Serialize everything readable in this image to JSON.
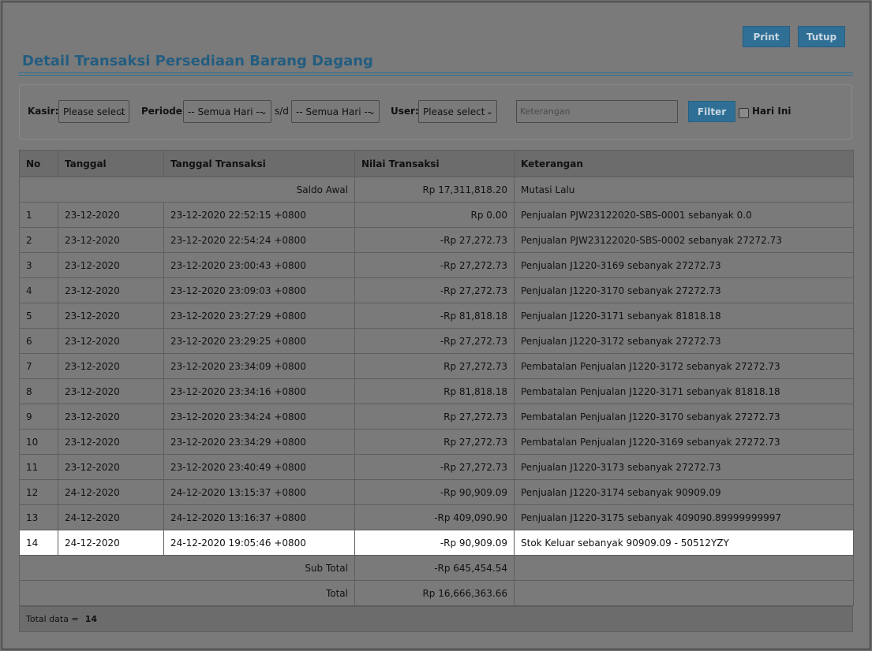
{
  "toolbar": {
    "print_label": "Print",
    "close_label": "Tutup"
  },
  "page_title": "Detail Transaksi Persediaan Barang Dagang",
  "filter": {
    "kasir_label": "Kasir:",
    "kasir_value": "Please select",
    "periode_label": "Periode:",
    "periode_from": "-- Semua Hari --",
    "sd_label": "s/d",
    "periode_to": "-- Semua Hari --",
    "user_label": "User:",
    "user_value": "Please select",
    "keterangan_placeholder": "Keterangan",
    "filter_label": "Filter",
    "hari_ini_label": "Hari Ini"
  },
  "table": {
    "headers": [
      "No",
      "Tanggal",
      "Tanggal Transaksi",
      "Nilai Transaksi",
      "Keterangan"
    ],
    "saldo_awal": {
      "label": "Saldo Awal",
      "value": "Rp 17,311,818.20",
      "keterangan": "Mutasi Lalu"
    },
    "rows": [
      [
        "1",
        "23-12-2020",
        "23-12-2020 22:52:15 +0800",
        "Rp 0.00",
        "Penjualan PJW23122020-SBS-0001 sebanyak 0.0"
      ],
      [
        "2",
        "23-12-2020",
        "23-12-2020 22:54:24 +0800",
        "-Rp 27,272.73",
        "Penjualan PJW23122020-SBS-0002 sebanyak 27272.73"
      ],
      [
        "3",
        "23-12-2020",
        "23-12-2020 23:00:43 +0800",
        "-Rp 27,272.73",
        "Penjualan J1220-3169 sebanyak 27272.73"
      ],
      [
        "4",
        "23-12-2020",
        "23-12-2020 23:09:03 +0800",
        "-Rp 27,272.73",
        "Penjualan J1220-3170 sebanyak 27272.73"
      ],
      [
        "5",
        "23-12-2020",
        "23-12-2020 23:27:29 +0800",
        "-Rp 81,818.18",
        "Penjualan J1220-3171 sebanyak 81818.18"
      ],
      [
        "6",
        "23-12-2020",
        "23-12-2020 23:29:25 +0800",
        "-Rp 27,272.73",
        "Penjualan J1220-3172 sebanyak 27272.73"
      ],
      [
        "7",
        "23-12-2020",
        "23-12-2020 23:34:09 +0800",
        "Rp 27,272.73",
        "Pembatalan Penjualan J1220-3172 sebanyak 27272.73"
      ],
      [
        "8",
        "23-12-2020",
        "23-12-2020 23:34:16 +0800",
        "Rp 81,818.18",
        "Pembatalan Penjualan J1220-3171 sebanyak 81818.18"
      ],
      [
        "9",
        "23-12-2020",
        "23-12-2020 23:34:24 +0800",
        "Rp 27,272.73",
        "Pembatalan Penjualan J1220-3170 sebanyak 27272.73"
      ],
      [
        "10",
        "23-12-2020",
        "23-12-2020 23:34:29 +0800",
        "Rp 27,272.73",
        "Pembatalan Penjualan J1220-3169 sebanyak 27272.73"
      ],
      [
        "11",
        "23-12-2020",
        "23-12-2020 23:40:49 +0800",
        "-Rp 27,272.73",
        "Penjualan J1220-3173 sebanyak 27272.73"
      ],
      [
        "12",
        "24-12-2020",
        "24-12-2020 13:15:37 +0800",
        "-Rp 90,909.09",
        "Penjualan J1220-3174 sebanyak 90909.09"
      ],
      [
        "13",
        "24-12-2020",
        "24-12-2020 13:16:37 +0800",
        "-Rp 409,090.90",
        "Penjualan J1220-3175 sebanyak 409090.89999999997"
      ],
      [
        "14",
        "24-12-2020",
        "24-12-2020 19:05:46 +0800",
        "-Rp 90,909.09",
        "Stok Keluar sebanyak 90909.09 - 50512YZY"
      ]
    ],
    "highlighted_row": 13,
    "sub_total": {
      "label": "Sub Total",
      "value": "-Rp 645,454.54"
    },
    "total": {
      "label": "Total",
      "value": "Rp 16,666,363.66"
    }
  },
  "footer": {
    "label": "Total data =",
    "count": "14"
  }
}
